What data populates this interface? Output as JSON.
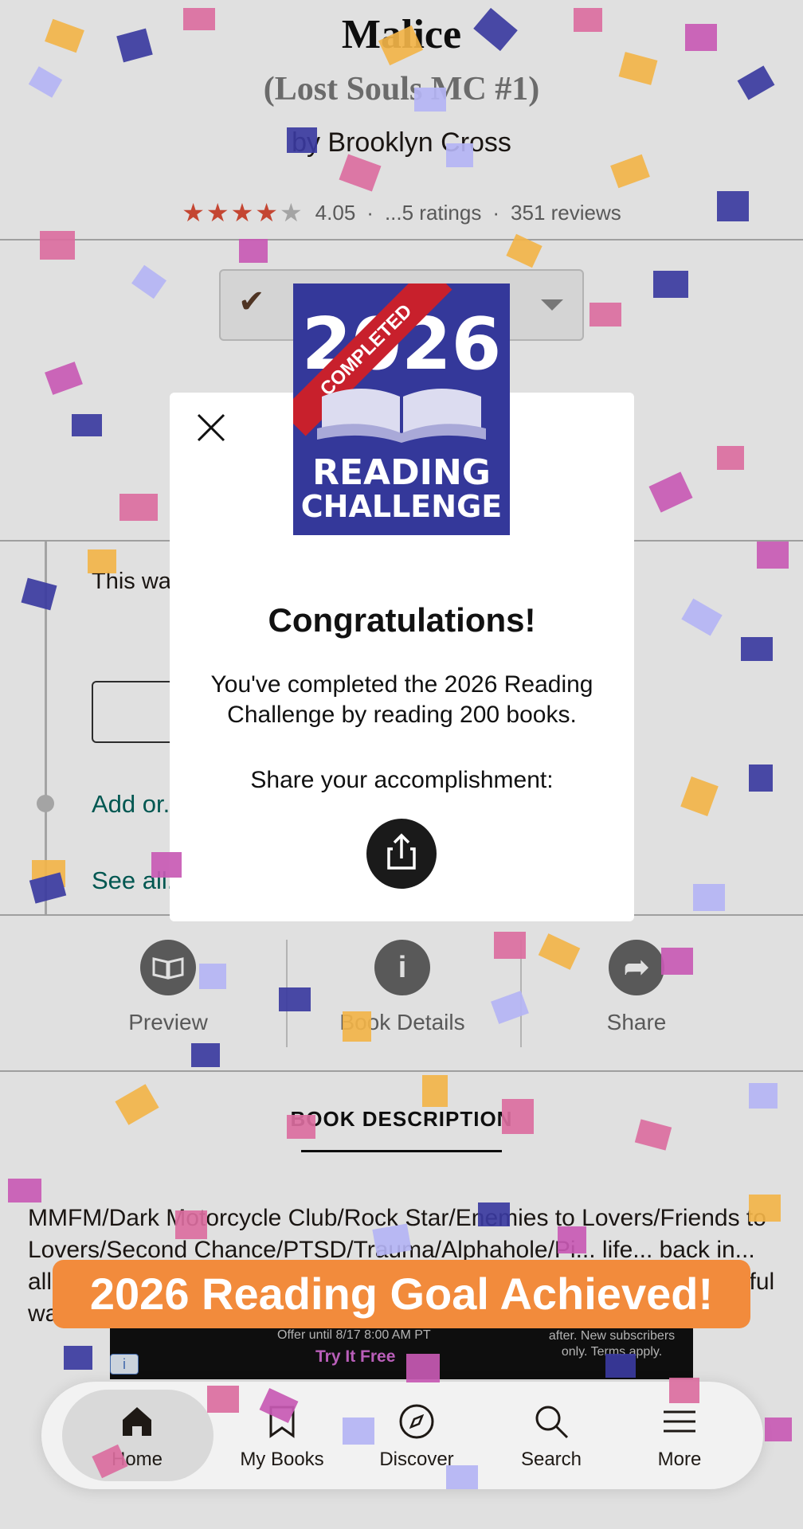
{
  "book": {
    "title": "Malice",
    "series": "(Lost Souls MC #1)",
    "author": "by Brooklyn Cross",
    "avg_rating": "4.05",
    "ratings_count": "...5 ratings",
    "reviews_count": "351 reviews",
    "stars_filled": 4,
    "stars_total": 5
  },
  "review": {
    "text_visible": "This wa... the characs... warning there is a...",
    "add_link": "Add or...",
    "see_all_link": "See all..."
  },
  "actions": {
    "preview": "Preview",
    "details": "Book Details",
    "share": "Share"
  },
  "description": {
    "heading": "BOOK DESCRIPTION",
    "text": "MMFM/Dark Motorcycle Club/Rock Star/Enemies to Lovers/Friends to Lovers/Second Chance/PTSD/Trauma/Alphahole/Pi... life... back in... all blue eyes ar... In... a... mo... ripped out of my chest in such a painful way that I never"
  },
  "ad": {
    "line1": "Offer until 8/17 8:00 AM PT",
    "cta": "Try It Free",
    "line2": "after. New subscribers only. Terms apply."
  },
  "modal": {
    "badge_year": "2026",
    "badge_ribbon": "COMPLETED",
    "badge_line1": "READING",
    "badge_line2": "CHALLENGE",
    "heading": "Congratulations!",
    "message": "You've completed the 2026 Reading Challenge by reading 200 books.",
    "share_prompt": "Share your accomplishment:"
  },
  "goal_banner": "2026 Reading Goal Achieved!",
  "nav": [
    {
      "label": "Home",
      "icon": "home-icon",
      "active": true
    },
    {
      "label": "My Books",
      "icon": "bookmark-icon",
      "active": false
    },
    {
      "label": "Discover",
      "icon": "compass-icon",
      "active": false
    },
    {
      "label": "Search",
      "icon": "search-icon",
      "active": false
    },
    {
      "label": "More",
      "icon": "menu-icon",
      "active": false
    }
  ],
  "colors": {
    "brand_green": "#00635d",
    "badge_blue": "#34389a",
    "ribbon_red": "#c8202c",
    "banner_orange": "#f28b3c",
    "star_red": "#e0503a"
  }
}
